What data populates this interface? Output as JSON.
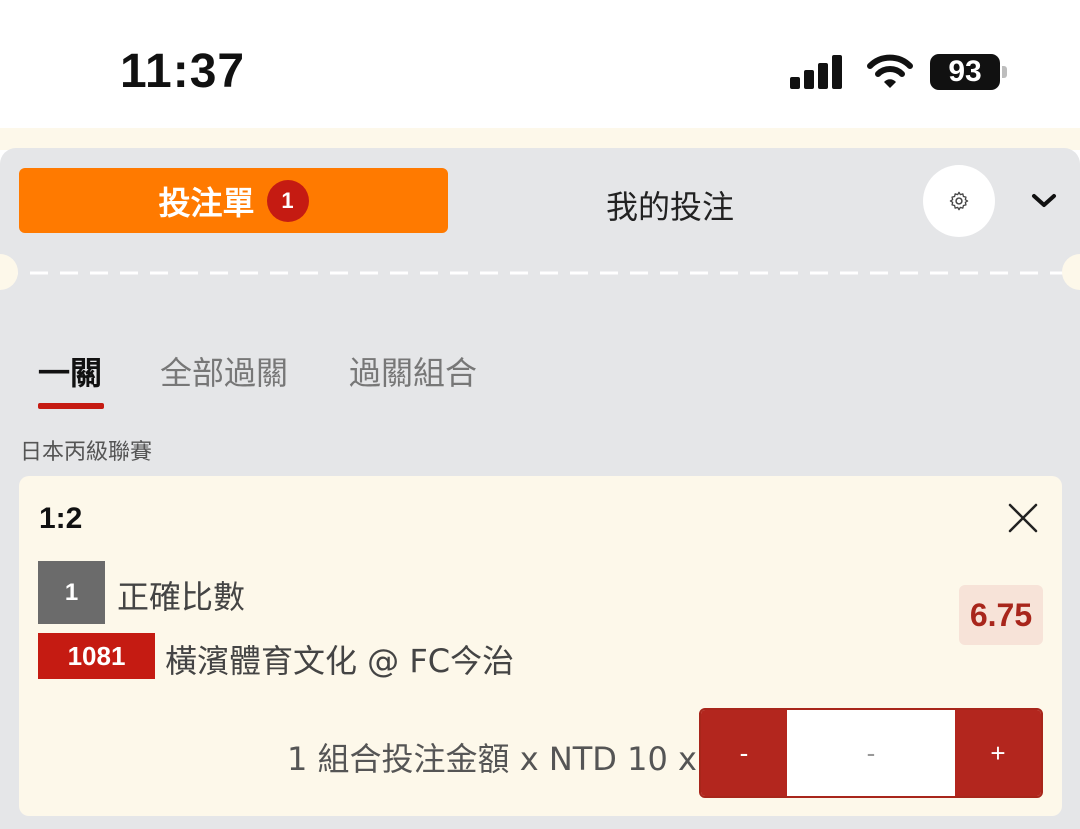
{
  "status_bar": {
    "time": "11:37",
    "battery": "93",
    "icons": [
      "signal-icon",
      "wifi-icon",
      "battery-icon"
    ]
  },
  "header": {
    "betslip_tab": "投注單",
    "betslip_count": "1",
    "mybets_tab": "我的投注",
    "icons": [
      "gear-icon",
      "chevron-down-icon"
    ]
  },
  "subtabs": [
    "一關",
    "全部過關",
    "過關組合"
  ],
  "league": "日本丙級聯賽",
  "bet": {
    "selection": "1:2",
    "bet_no": "1",
    "bet_type": "正確比數",
    "match_no": "1081",
    "match_name": "橫濱體育文化 @ FC今治",
    "odds": "6.75",
    "stake_label": "1 組合投注金額 x NTD 10 x",
    "minus": "-",
    "value": "-",
    "plus": "+"
  },
  "colors": {
    "accent_orange": "#ff7a00",
    "brand_red": "#c51b12",
    "card_bg": "#fdf8ea",
    "sheet_bg": "#e5e6e8"
  }
}
